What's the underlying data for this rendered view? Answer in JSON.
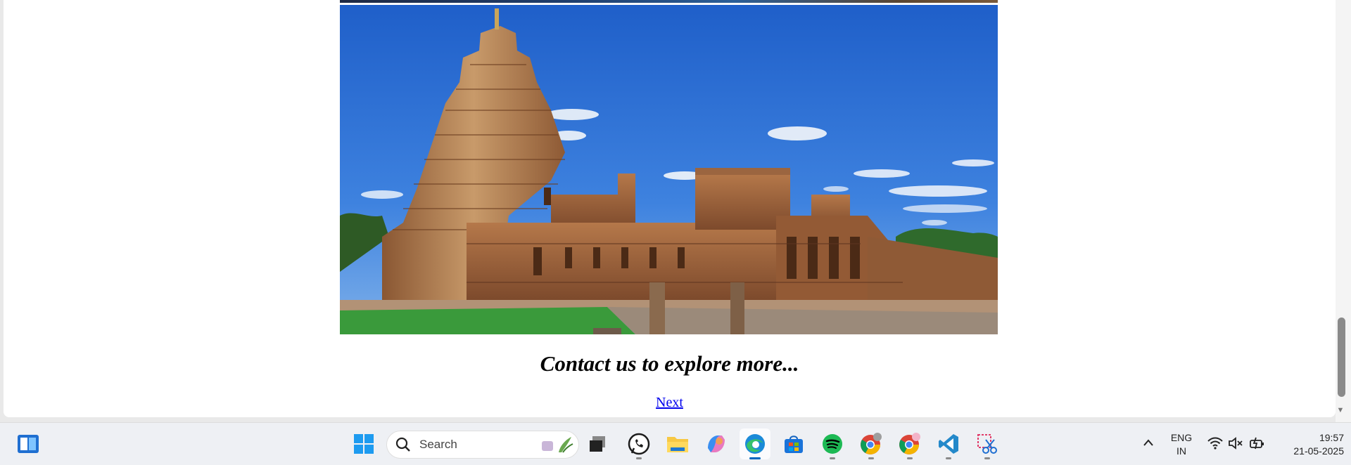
{
  "page": {
    "caption": "Contact us to explore more...",
    "next_link": "Next",
    "image_subject": "temple-photo"
  },
  "taskbar": {
    "search_label": "Search",
    "apps": [
      "widgets-icon",
      "start-icon",
      "task-view-icon",
      "whatsapp-icon",
      "file-explorer-icon",
      "copilot-icon",
      "edge-icon",
      "store-icon",
      "spotify-icon",
      "chrome-icon",
      "chrome-profile-icon",
      "vscode-icon",
      "snipping-tool-icon"
    ],
    "tray": {
      "lang_top": "ENG",
      "lang_bottom": "IN",
      "time": "19:57",
      "date": "21-05-2025"
    }
  },
  "colors": {
    "accent": "#0067c0",
    "link": "#0000ee",
    "sky": "#2f74d8",
    "stone": "#a8643a"
  }
}
